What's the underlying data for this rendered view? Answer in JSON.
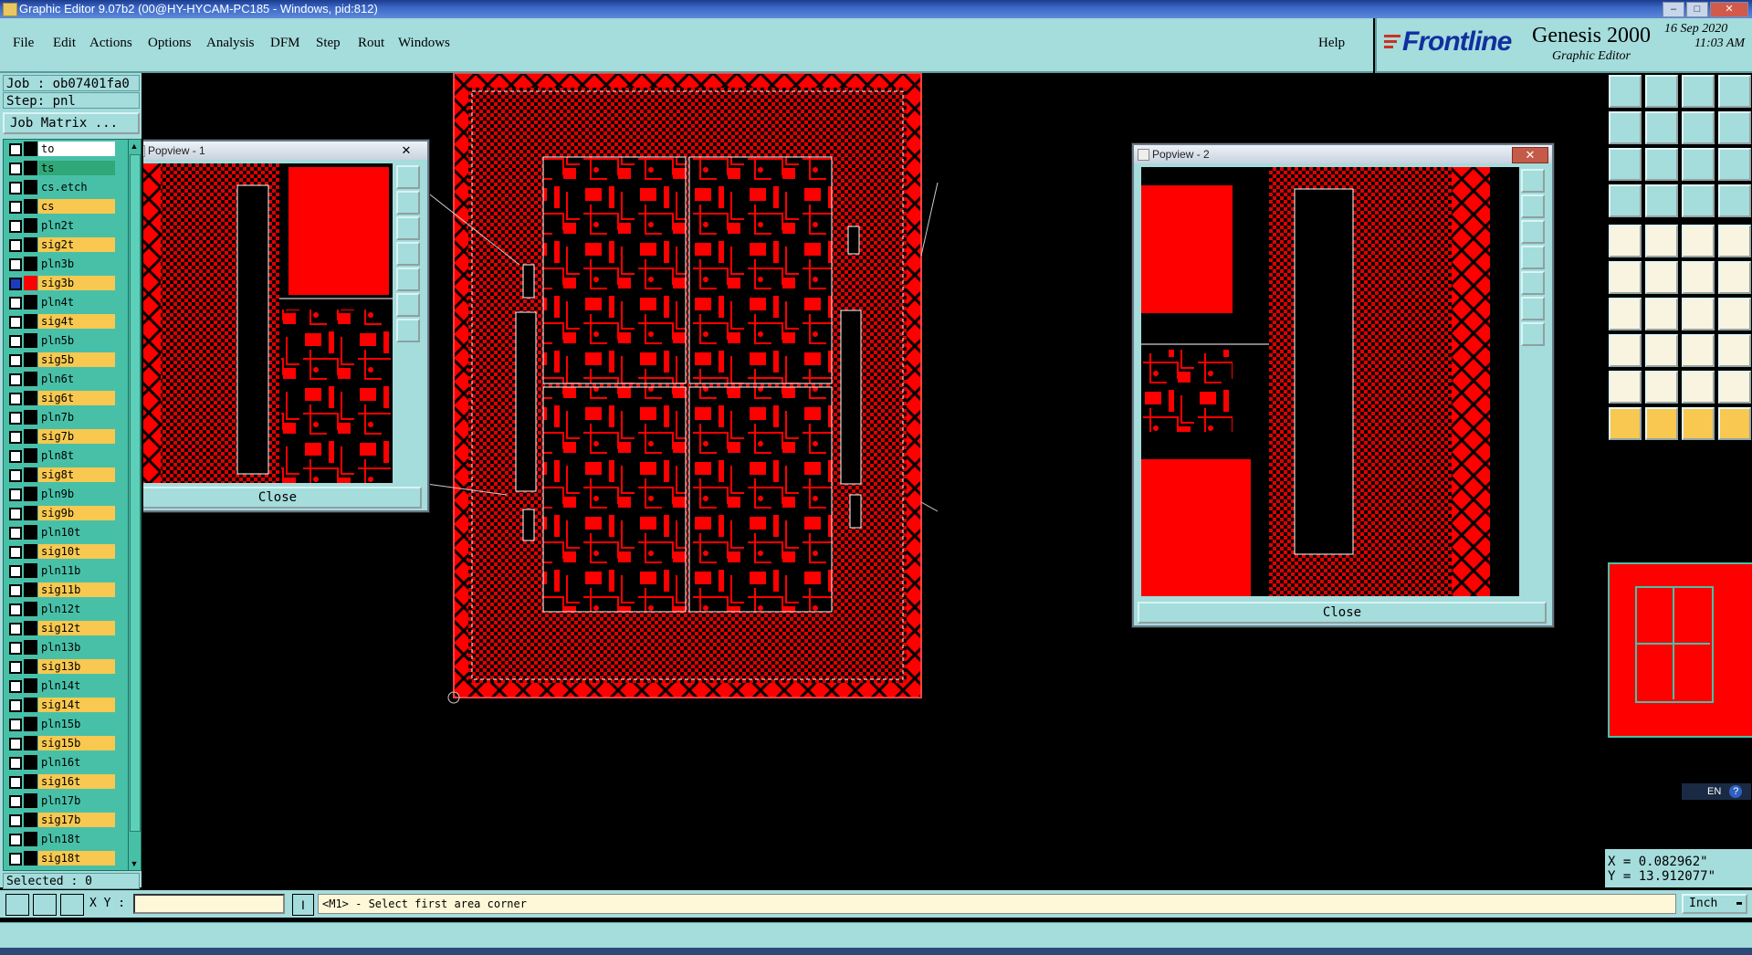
{
  "window": {
    "title": "Graphic Editor 9.07b2 (00@HY-HYCAM-PC185 - Windows, pid:812)"
  },
  "menu": {
    "items": [
      "File",
      "Edit",
      "Actions",
      "Options",
      "Analysis",
      "DFM",
      "Step",
      "Rout",
      "Windows"
    ],
    "help": "Help"
  },
  "brand": {
    "logo": "Frontline",
    "product": "Genesis 2000",
    "subtitle": "Graphic Editor",
    "date": "16 Sep 2020",
    "time": "11:03 AM"
  },
  "job": {
    "job_label": "Job : ob07401fa0",
    "step_label": "Step: pnl",
    "matrix_button": "Job Matrix ...",
    "selected": "Selected : 0"
  },
  "layers": [
    {
      "name": "to",
      "color": "#ffffff",
      "side": "#000000",
      "checked": false
    },
    {
      "name": "ts",
      "color": "#30a878",
      "side": "#000000",
      "checked": false
    },
    {
      "name": "cs.etch",
      "color": "#48c0a8",
      "side": "#000000",
      "checked": false
    },
    {
      "name": "cs",
      "color": "#f8c850",
      "side": "#000000",
      "checked": false
    },
    {
      "name": "pln2t",
      "color": "#48c0a8",
      "side": "#000000",
      "checked": false
    },
    {
      "name": "sig2t",
      "color": "#f8c850",
      "side": "#000000",
      "checked": false
    },
    {
      "name": "pln3b",
      "color": "#48c0a8",
      "side": "#000000",
      "checked": false
    },
    {
      "name": "sig3b",
      "color": "#f8c850",
      "side": "#ff0000",
      "checked": true
    },
    {
      "name": "pln4t",
      "color": "#48c0a8",
      "side": "#000000",
      "checked": false
    },
    {
      "name": "sig4t",
      "color": "#f8c850",
      "side": "#000000",
      "checked": false
    },
    {
      "name": "pln5b",
      "color": "#48c0a8",
      "side": "#000000",
      "checked": false
    },
    {
      "name": "sig5b",
      "color": "#f8c850",
      "side": "#000000",
      "checked": false
    },
    {
      "name": "pln6t",
      "color": "#48c0a8",
      "side": "#000000",
      "checked": false
    },
    {
      "name": "sig6t",
      "color": "#f8c850",
      "side": "#000000",
      "checked": false
    },
    {
      "name": "pln7b",
      "color": "#48c0a8",
      "side": "#000000",
      "checked": false
    },
    {
      "name": "sig7b",
      "color": "#f8c850",
      "side": "#000000",
      "checked": false
    },
    {
      "name": "pln8t",
      "color": "#48c0a8",
      "side": "#000000",
      "checked": false
    },
    {
      "name": "sig8t",
      "color": "#f8c850",
      "side": "#000000",
      "checked": false
    },
    {
      "name": "pln9b",
      "color": "#48c0a8",
      "side": "#000000",
      "checked": false
    },
    {
      "name": "sig9b",
      "color": "#f8c850",
      "side": "#000000",
      "checked": false
    },
    {
      "name": "pln10t",
      "color": "#48c0a8",
      "side": "#000000",
      "checked": false
    },
    {
      "name": "sig10t",
      "color": "#f8c850",
      "side": "#000000",
      "checked": false
    },
    {
      "name": "pln11b",
      "color": "#48c0a8",
      "side": "#000000",
      "checked": false
    },
    {
      "name": "sig11b",
      "color": "#f8c850",
      "side": "#000000",
      "checked": false
    },
    {
      "name": "pln12t",
      "color": "#48c0a8",
      "side": "#000000",
      "checked": false
    },
    {
      "name": "sig12t",
      "color": "#f8c850",
      "side": "#000000",
      "checked": false
    },
    {
      "name": "pln13b",
      "color": "#48c0a8",
      "side": "#000000",
      "checked": false
    },
    {
      "name": "sig13b",
      "color": "#f8c850",
      "side": "#000000",
      "checked": false
    },
    {
      "name": "pln14t",
      "color": "#48c0a8",
      "side": "#000000",
      "checked": false
    },
    {
      "name": "sig14t",
      "color": "#f8c850",
      "side": "#000000",
      "checked": false
    },
    {
      "name": "pln15b",
      "color": "#48c0a8",
      "side": "#000000",
      "checked": false
    },
    {
      "name": "sig15b",
      "color": "#f8c850",
      "side": "#000000",
      "checked": false
    },
    {
      "name": "pln16t",
      "color": "#48c0a8",
      "side": "#000000",
      "checked": false
    },
    {
      "name": "sig16t",
      "color": "#f8c850",
      "side": "#000000",
      "checked": false
    },
    {
      "name": "pln17b",
      "color": "#48c0a8",
      "side": "#000000",
      "checked": false
    },
    {
      "name": "sig17b",
      "color": "#f8c850",
      "side": "#000000",
      "checked": false
    },
    {
      "name": "pln18t",
      "color": "#48c0a8",
      "side": "#000000",
      "checked": false
    },
    {
      "name": "sig18t",
      "color": "#f8c850",
      "side": "#000000",
      "checked": false
    }
  ],
  "popview1": {
    "title": "Popview - 1",
    "close_x": "✕",
    "close_button": "Close"
  },
  "popview2": {
    "title": "Popview - 2",
    "close_x": "✕",
    "close_button": "Close"
  },
  "coords": {
    "x": "X = 0.082962\"",
    "y": "Y = 13.912077\""
  },
  "status": {
    "xy_label": "X Y :",
    "xy_value": "",
    "prompt": "<M1> - Select first area corner",
    "units": "Inch"
  },
  "lang": {
    "label": "EN"
  },
  "colors": {
    "panel": "#a5dcdc",
    "layer_bg": "#48c0a8",
    "board": "#ff0000",
    "yellow": "#f8c850"
  }
}
